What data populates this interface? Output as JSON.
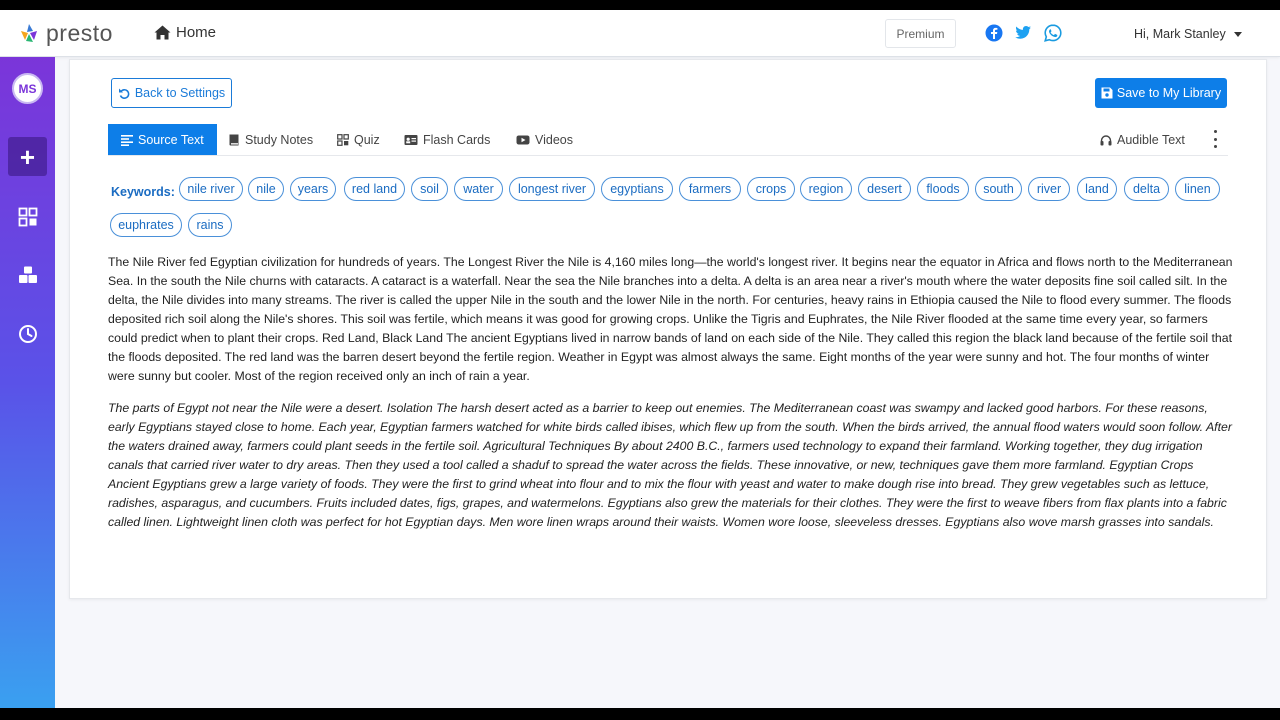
{
  "app": {
    "logo_text": "presto",
    "home_label": "Home",
    "premium_label": "Premium",
    "greeting": "Hi, Mark Stanley",
    "social_icons": [
      "facebook-icon",
      "twitter-icon",
      "whatsapp-icon"
    ],
    "colors": {
      "primary": "#0d7ee8",
      "sidebar_top": "#7b35d9",
      "sidebar_bottom": "#3aa0f0",
      "facebook": "#1877f2",
      "twitter": "#1da1f2",
      "whatsapp": "#1a9be0"
    }
  },
  "sidebar": {
    "avatar_initials": "MS",
    "items": [
      {
        "icon": "plus-icon"
      },
      {
        "icon": "dashboard-icon"
      },
      {
        "icon": "boxes-icon"
      },
      {
        "icon": "clock-icon"
      }
    ]
  },
  "toolbar": {
    "back_label": "Back to Settings",
    "save_label": "Save to My Library"
  },
  "tabs": [
    {
      "label": "Source Text",
      "icon": "align-left-icon",
      "active": true
    },
    {
      "label": "Study Notes",
      "icon": "book-icon",
      "active": false
    },
    {
      "label": "Quiz",
      "icon": "quiz-icon",
      "active": false
    },
    {
      "label": "Flash Cards",
      "icon": "id-card-icon",
      "active": false
    },
    {
      "label": "Videos",
      "icon": "youtube-icon",
      "active": false
    },
    {
      "label": "Audible Text",
      "icon": "headphones-icon",
      "active": false
    }
  ],
  "keywords": {
    "label": "Keywords:",
    "items": [
      "nile river",
      "nile",
      "years",
      "red land",
      "soil",
      "water",
      "longest river",
      "egyptians",
      "farmers",
      "crops",
      "region",
      "desert",
      "floods",
      "south",
      "river",
      "land",
      "delta",
      "linen",
      "euphrates",
      "rains"
    ]
  },
  "content": {
    "paragraph1": "The Nile River fed Egyptian civilization for hundreds of years. The Longest River the Nile is 4,160 miles long—the world's longest river. It begins near the equator in Africa and flows north to the Mediterranean Sea. In the south the Nile churns with cataracts. A cataract is a waterfall. Near the sea the Nile branches into a delta. A delta is an area near a river's mouth where the water deposits fine soil called silt. In the delta, the Nile divides into many streams. The river is called the upper Nile in the south and the lower Nile in the north. For centuries, heavy rains in Ethiopia caused the Nile to flood every summer. The floods deposited rich soil along the Nile's shores. This soil was fertile, which means it was good for growing crops. Unlike the Tigris and Euphrates, the Nile River flooded at the same time every year, so farmers could predict when to plant their crops. Red Land, Black Land The ancient Egyptians lived in narrow bands of land on each side of the Nile. They called this region the black land because of the fertile soil that the floods deposited. The red land was the barren desert beyond the fertile region. Weather in Egypt was almost always the same. Eight months of the year were sunny and hot. The four months of winter were sunny but cooler. Most of the region received only an inch of rain a year.",
    "paragraph2": "The parts of Egypt not near the Nile were a desert. Isolation The harsh desert acted as a barrier to keep out enemies. The Mediterranean coast was swampy and lacked good harbors. For these reasons, early Egyptians stayed close to home. Each year, Egyptian farmers watched for white birds called ibises, which flew up from the south. When the birds arrived, the annual flood waters would soon follow. After the waters drained away, farmers could plant seeds in the fertile soil. Agricultural Techniques By about 2400 B.C., farmers used technology to expand their farmland. Working together, they dug irrigation canals that carried river water to dry areas. Then they used a tool called a shaduf to spread the water across the fields. These innovative, or new, techniques gave them more farmland. Egyptian Crops Ancient Egyptians grew a large variety of foods. They were the first to grind wheat into flour and to mix the flour with yeast and water to make dough rise into bread. They grew vegetables such as lettuce, radishes, asparagus, and cucumbers. Fruits included dates, figs, grapes, and watermelons. Egyptians also grew the materials for their clothes. They were the first to weave fibers from flax plants into a fabric called linen. Lightweight linen cloth was perfect for hot Egyptian days. Men wore linen wraps around their waists. Women wore loose, sleeveless dresses. Egyptians also wove marsh grasses into sandals."
  }
}
